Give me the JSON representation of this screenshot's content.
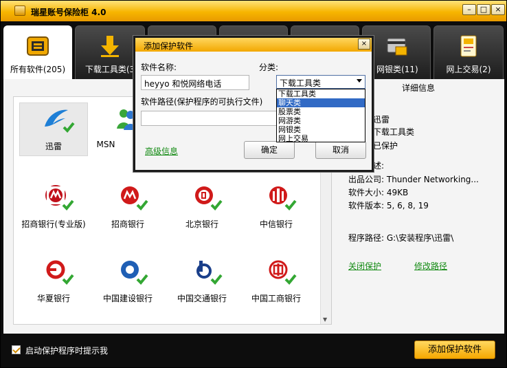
{
  "window": {
    "title": "瑞星账号保险柜 4.0",
    "minimize": "–",
    "restore": "□",
    "close": "×"
  },
  "tabs": [
    {
      "label": "所有软件(205)",
      "icon": "all-software-icon",
      "active": true
    },
    {
      "label": "下载工具类(3",
      "icon": "download-arrow-icon",
      "active": false
    },
    {
      "label": "",
      "icon": "chat-icon",
      "active": false
    },
    {
      "label": "",
      "icon": "stock-icon",
      "active": false
    },
    {
      "label": "",
      "icon": "game-icon",
      "active": false
    },
    {
      "label": "网银类(11)",
      "icon": "bank-card-icon",
      "active": false
    },
    {
      "label": "网上交易",
      "icon": "shopping-icon",
      "active": false
    },
    {
      "label": "(2)",
      "icon": "",
      "active": false
    }
  ],
  "tab_labels": {
    "all": "所有软件(205)",
    "download": "下载工具类(3",
    "bank": "网银类(11)",
    "trade": "网上交易(2)"
  },
  "software": [
    {
      "label": "迅雷",
      "icon": "thunder-bird-icon",
      "selected": true
    },
    {
      "label": "MSN",
      "icon": "msn-people-icon",
      "selected": false
    },
    {
      "label": "招商银行(专业版)",
      "icon": "cmb-logo-icon",
      "selected": false
    },
    {
      "label": "招商银行",
      "icon": "cmb-logo-icon",
      "selected": false
    },
    {
      "label": "北京银行",
      "icon": "bank-of-beijing-icon",
      "selected": false
    },
    {
      "label": "中信银行",
      "icon": "citic-bank-icon",
      "selected": false
    },
    {
      "label": "华夏银行",
      "icon": "hua-xia-bank-icon",
      "selected": false
    },
    {
      "label": "中国建设银行",
      "icon": "ccb-icon",
      "selected": false
    },
    {
      "label": "中国交通银行",
      "icon": "bankcomm-icon",
      "selected": false
    },
    {
      "label": "中国工商银行",
      "icon": "icbc-icon",
      "selected": false
    }
  ],
  "detail": {
    "header": "详细信息",
    "name": "迅雷",
    "category": "下载工具类",
    "status": "已保护",
    "desc_label": "述:",
    "publisher": "出品公司: Thunder Networking...",
    "size": "软件大小: 49KB",
    "version": "软件版本: 5, 6, 8, 19",
    "path": "程序路径: G:\\安装程序\\迅雷\\",
    "close_protect": "关闭保护",
    "modify_path": "修改路径"
  },
  "footer": {
    "checkbox_label": "启动保护程序时提示我",
    "checked": true,
    "add_button": "添加保护软件"
  },
  "dialog": {
    "title": "添加保护软件",
    "close": "×",
    "name_label": "软件名称:",
    "name_value": "heyyo 和悦网络电话",
    "category_label": "分类:",
    "category_value": "下载工具类",
    "category_options": [
      "下载工具类",
      "聊天类",
      "股票类",
      "网游类",
      "网银类",
      "网上交易"
    ],
    "highlighted_option": "聊天类",
    "path_label": "软件路径(保护程序的可执行文件)",
    "path_value": "",
    "advanced_link": "高级信息",
    "ok_button": "确定",
    "cancel_button": "取消"
  },
  "colors": {
    "titlebar": "#f7b500",
    "accent_green": "#138a13",
    "highlight_blue": "#316ac5",
    "bank_red": "#d01a1a"
  }
}
